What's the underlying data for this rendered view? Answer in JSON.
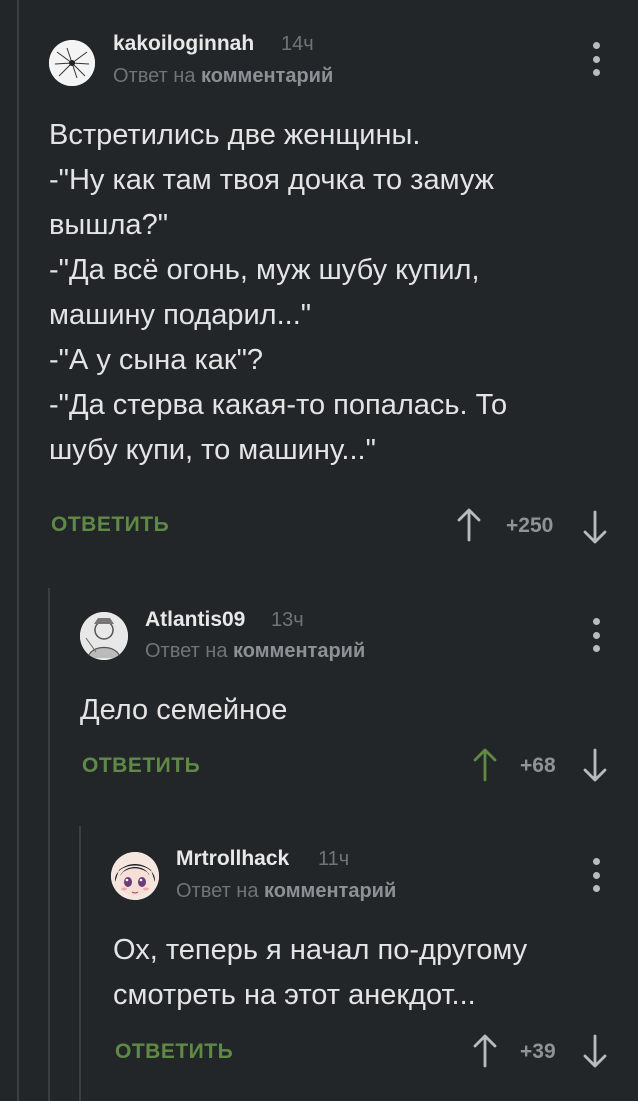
{
  "comments": [
    {
      "username": "kakoiloginnah",
      "time": "14ч",
      "reply_prefix": "Ответ на",
      "reply_target": "комментарий",
      "lines": [
        "Встретились две женщины.",
        "-\"Ну как там твоя дочка то замуж",
        "вышла?\"",
        "-\"Да всё огонь, муж шубу купил,",
        "машину подарил...\"",
        "-\"А у сына как\"?",
        "-\"Да стерва какая-то попалась. То",
        "шубу купи, то машину...\""
      ],
      "reply_label": "ОТВЕТИТЬ",
      "score": "+250",
      "upvoted": false
    },
    {
      "username": "Atlantis09",
      "time": "13ч",
      "reply_prefix": "Ответ на",
      "reply_target": "комментарий",
      "lines": [
        "Дело семейное"
      ],
      "reply_label": "ОТВЕТИТЬ",
      "score": "+68",
      "upvoted": true
    },
    {
      "username": "Mrtrollhack",
      "time": "11ч",
      "reply_prefix": "Ответ на",
      "reply_target": "комментарий",
      "lines": [
        "Ох, теперь я начал по-другому",
        "смотреть на этот анекдот..."
      ],
      "reply_label": "ОТВЕТИТЬ",
      "score": "+39",
      "upvoted": false
    }
  ],
  "colors": {
    "background": "#232629",
    "reply_button": "#5f8a46",
    "upvote_active": "#5f8a46",
    "vote_inactive": "#b9bcbf",
    "thread_line": "#3a3e42"
  },
  "icons": {
    "upvote": "arrow-up-icon",
    "downvote": "arrow-down-icon",
    "menu": "more-vertical-icon"
  }
}
